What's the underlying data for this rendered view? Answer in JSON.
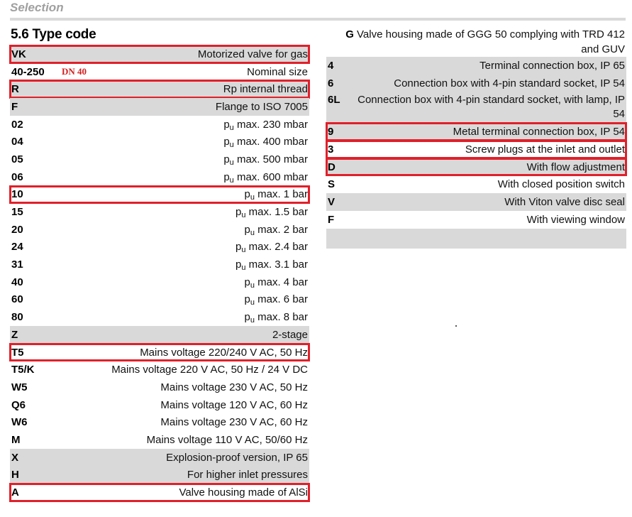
{
  "section_header": "Selection",
  "title": "5.6 Type code",
  "highlight_color": "#e0202a",
  "row_gray_color": "#d9d9d9",
  "left_rows": [
    {
      "code": "VK",
      "desc": "Motorized valve for gas",
      "gray": true,
      "highlight": true
    },
    {
      "code": "40-250",
      "note": "DN 40",
      "desc": "Nominal size",
      "gray": false,
      "highlight": false
    },
    {
      "code": "R",
      "desc": "Rp internal thread",
      "gray": true,
      "highlight": true
    },
    {
      "code": "F",
      "desc": "Flange to ISO 7005",
      "gray": true,
      "highlight": false
    },
    {
      "code": "02",
      "desc_prefix": "p",
      "desc_sub": "u",
      "desc": " max. 230 mbar",
      "gray": false,
      "highlight": false
    },
    {
      "code": "04",
      "desc_prefix": "p",
      "desc_sub": "u",
      "desc": " max. 400 mbar",
      "gray": false,
      "highlight": false
    },
    {
      "code": "05",
      "desc_prefix": "p",
      "desc_sub": "u",
      "desc": " max. 500 mbar",
      "gray": false,
      "highlight": false
    },
    {
      "code": "06",
      "desc_prefix": "p",
      "desc_sub": "u",
      "desc": " max. 600 mbar",
      "gray": false,
      "highlight": false
    },
    {
      "code": "10",
      "desc_prefix": "p",
      "desc_sub": "u",
      "desc": " max. 1 bar",
      "gray": false,
      "highlight": true
    },
    {
      "code": "15",
      "desc_prefix": "p",
      "desc_sub": "u",
      "desc": " max. 1.5 bar",
      "gray": false,
      "highlight": false
    },
    {
      "code": "20",
      "desc_prefix": "p",
      "desc_sub": "u",
      "desc": " max. 2 bar",
      "gray": false,
      "highlight": false
    },
    {
      "code": "24",
      "desc_prefix": "p",
      "desc_sub": "u",
      "desc": " max. 2.4 bar",
      "gray": false,
      "highlight": false
    },
    {
      "code": "31",
      "desc_prefix": "p",
      "desc_sub": "u",
      "desc": " max. 3.1 bar",
      "gray": false,
      "highlight": false
    },
    {
      "code": "40",
      "desc_prefix": "p",
      "desc_sub": "u",
      "desc": " max. 4 bar",
      "gray": false,
      "highlight": false
    },
    {
      "code": "60",
      "desc_prefix": "p",
      "desc_sub": "u",
      "desc": " max. 6 bar",
      "gray": false,
      "highlight": false
    },
    {
      "code": "80",
      "desc_prefix": "p",
      "desc_sub": "u",
      "desc": " max. 8 bar",
      "gray": false,
      "highlight": false
    },
    {
      "code": "Z",
      "desc": "2-stage",
      "gray": true,
      "highlight": false
    },
    {
      "code": "T5",
      "desc": "Mains voltage 220/240 V AC, 50 Hz",
      "gray": false,
      "highlight": true
    },
    {
      "code": "T5/K",
      "desc": "Mains voltage 220 V AC, 50 Hz / 24 V DC",
      "gray": false,
      "highlight": false
    },
    {
      "code": "W5",
      "desc": "Mains voltage 230 V AC, 50 Hz",
      "gray": false,
      "highlight": false
    },
    {
      "code": "Q6",
      "desc": "Mains voltage 120 V AC, 60 Hz",
      "gray": false,
      "highlight": false
    },
    {
      "code": "W6",
      "desc": "Mains voltage 230 V AC, 60 Hz",
      "gray": false,
      "highlight": false
    },
    {
      "code": "M",
      "desc": "Mains voltage 110 V AC, 50/60 Hz",
      "gray": false,
      "highlight": false
    },
    {
      "code": "X",
      "desc": "Explosion-proof version, IP 65",
      "gray": true,
      "highlight": false
    },
    {
      "code": "H",
      "desc": "For higher inlet pressures",
      "gray": true,
      "highlight": false
    },
    {
      "code": "A",
      "desc": "Valve housing made of AlSi",
      "gray": false,
      "highlight": true
    }
  ],
  "right_rows": [
    {
      "code": "G",
      "desc": "Valve housing made of GGG 50 complying with TRD 412 and GUV",
      "line1": "Valve housing made of GGG 50 complying with TRD 412",
      "line2": "and GUV",
      "gray": false,
      "highlight": false,
      "kind": "g"
    },
    {
      "code": "4",
      "desc": "Terminal connection box, IP 65",
      "gray": true,
      "highlight": false
    },
    {
      "code": "6",
      "desc": "Connection box with 4-pin standard socket, IP 54",
      "gray": true,
      "highlight": false
    },
    {
      "code": "6L",
      "desc": "Connection box with 4-pin standard socket, with lamp, IP 54",
      "gray": true,
      "highlight": false,
      "kind": "tall"
    },
    {
      "code": "9",
      "desc": "Metal terminal connection box, IP 54",
      "gray": true,
      "highlight": true
    },
    {
      "code": "3",
      "desc": "Screw plugs at the inlet and outlet",
      "gray": false,
      "highlight": true
    },
    {
      "code": "D",
      "desc": "With flow adjustment",
      "gray": true,
      "highlight": true
    },
    {
      "code": "S",
      "desc": "With closed position switch",
      "gray": false,
      "highlight": false
    },
    {
      "code": "V",
      "desc": "With Viton valve disc seal",
      "gray": true,
      "highlight": false
    },
    {
      "code": "F",
      "desc": "With viewing window",
      "gray": false,
      "highlight": false
    },
    {
      "code": "",
      "desc": "",
      "gray": true,
      "highlight": false,
      "kind": "empty"
    }
  ]
}
